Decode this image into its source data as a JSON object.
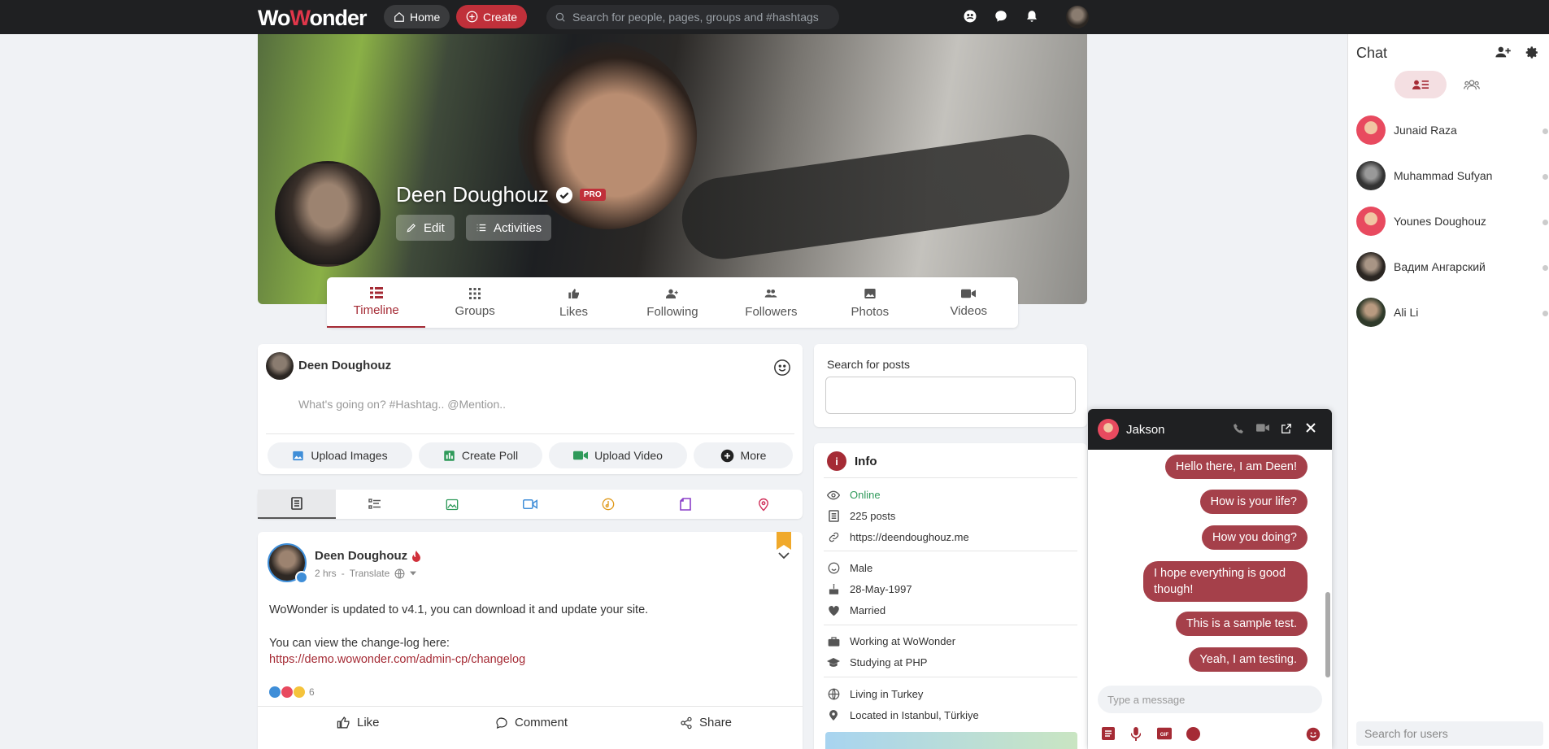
{
  "nav": {
    "logo_w": "Wo",
    "logo_o": "W",
    "logo_rest": "onder",
    "home_label": "Home",
    "create_label": "Create",
    "search_placeholder": "Search for people, pages, groups and #hashtags"
  },
  "profile": {
    "name": "Deen Doughouz",
    "pro_label": "PRO",
    "edit_label": "Edit",
    "activities_label": "Activities"
  },
  "tabs": [
    {
      "label": "Timeline",
      "icon": "timeline-icon"
    },
    {
      "label": "Groups",
      "icon": "groups-icon"
    },
    {
      "label": "Likes",
      "icon": "thumbs-up-icon"
    },
    {
      "label": "Following",
      "icon": "user-plus-icon"
    },
    {
      "label": "Followers",
      "icon": "users-icon"
    },
    {
      "label": "Photos",
      "icon": "image-icon"
    },
    {
      "label": "Videos",
      "icon": "video-icon"
    }
  ],
  "composer": {
    "user_name": "Deen Doughouz",
    "placeholder": "What's going on? #Hashtag.. @Mention..",
    "buttons": [
      "Upload Images",
      "Create Poll",
      "Upload Video",
      "More"
    ]
  },
  "post": {
    "author": "Deen Doughouz",
    "meta_time": "2 hrs",
    "meta_translate": "Translate",
    "line1": "WoWonder is updated to v4.1, you can download it and update your site.",
    "line2": "You can view the change-log here:",
    "link": "https://demo.wowonder.com/admin-cp/changelog",
    "reaction_count": "6",
    "actions": [
      "Like",
      "Comment",
      "Share"
    ]
  },
  "search_posts": {
    "label": "Search for posts"
  },
  "info": {
    "title": "Info",
    "status": "Online",
    "posts": "225 posts",
    "website": "https://deendoughouz.me",
    "gender": "Male",
    "birthday": "28-May-1997",
    "relationship": "Married",
    "work": "Working at WoWonder",
    "study": "Studying at PHP",
    "living": "Living in Turkey",
    "located": "Located in Istanbul, Türkiye"
  },
  "chat": {
    "title": "Chat",
    "users": [
      "Junaid Raza",
      "Muhammad Sufyan",
      "Younes Doughouz",
      "Вадим Ангарский",
      "Ali Li"
    ],
    "search_placeholder": "Search for users"
  },
  "chat_window": {
    "name": "Jakson",
    "messages": [
      "Hello there, I am Deen!",
      "How is your life?",
      "How you doing?",
      "I hope everything is good though!",
      "This is a sample test.",
      "Yeah, I am testing."
    ],
    "input_placeholder": "Type a message"
  },
  "colors": {
    "accent": "#a52b35",
    "create_btn": "#c0303a",
    "topbar": "#1f2022",
    "bubble": "#a5404a"
  }
}
